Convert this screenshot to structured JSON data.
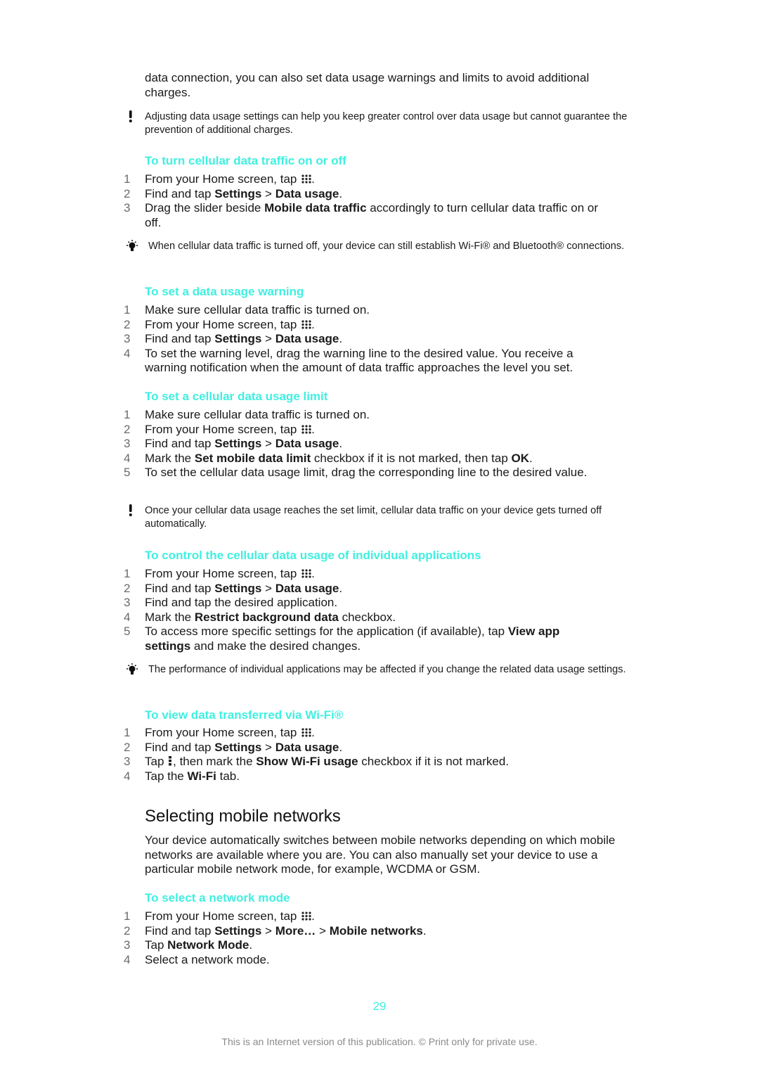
{
  "intro": {
    "text": "data connection, you can also set data usage warnings and limits to avoid additional charges."
  },
  "note_warning_1": {
    "icon": "exclamation-icon",
    "text": "Adjusting data usage settings can help you keep greater control over data usage but cannot guarantee the prevention of additional charges."
  },
  "sections": [
    {
      "heading": "To turn cellular data traffic on or off",
      "steps": [
        {
          "num": "1",
          "parts": [
            {
              "t": "From your Home screen, tap "
            },
            {
              "icon": "app-grid-icon"
            },
            {
              "t": "."
            }
          ]
        },
        {
          "num": "2",
          "parts": [
            {
              "t": "Find and tap "
            },
            {
              "b": "Settings"
            },
            {
              "t": " > "
            },
            {
              "b": "Data usage"
            },
            {
              "t": "."
            }
          ]
        },
        {
          "num": "3",
          "parts": [
            {
              "t": "Drag the slider beside "
            },
            {
              "b": "Mobile data traffic"
            },
            {
              "t": " accordingly to turn cellular data traffic on or off."
            }
          ]
        }
      ],
      "note": {
        "type": "tip",
        "icon": "lightbulb-icon",
        "text": "When cellular data traffic is turned off, your device can still establish Wi-Fi® and Bluetooth® connections."
      }
    },
    {
      "heading": "To set a data usage warning",
      "steps": [
        {
          "num": "1",
          "parts": [
            {
              "t": "Make sure cellular data traffic is turned on."
            }
          ]
        },
        {
          "num": "2",
          "parts": [
            {
              "t": "From your Home screen, tap "
            },
            {
              "icon": "app-grid-icon"
            },
            {
              "t": "."
            }
          ]
        },
        {
          "num": "3",
          "parts": [
            {
              "t": "Find and tap "
            },
            {
              "b": "Settings"
            },
            {
              "t": " > "
            },
            {
              "b": "Data usage"
            },
            {
              "t": "."
            }
          ]
        },
        {
          "num": "4",
          "parts": [
            {
              "t": "To set the warning level, drag the warning line to the desired value. You receive a warning notification when the amount of data traffic approaches the level you set."
            }
          ]
        }
      ]
    },
    {
      "heading": "To set a cellular data usage limit",
      "steps": [
        {
          "num": "1",
          "parts": [
            {
              "t": "Make sure cellular data traffic is turned on."
            }
          ]
        },
        {
          "num": "2",
          "parts": [
            {
              "t": "From your Home screen, tap "
            },
            {
              "icon": "app-grid-icon"
            },
            {
              "t": "."
            }
          ]
        },
        {
          "num": "3",
          "parts": [
            {
              "t": "Find and tap "
            },
            {
              "b": "Settings"
            },
            {
              "t": " > "
            },
            {
              "b": "Data usage"
            },
            {
              "t": "."
            }
          ]
        },
        {
          "num": "4",
          "parts": [
            {
              "t": "Mark the "
            },
            {
              "b": "Set mobile data limit"
            },
            {
              "t": " checkbox if it is not marked, then tap "
            },
            {
              "b": "OK"
            },
            {
              "t": "."
            }
          ]
        },
        {
          "num": "5",
          "parts": [
            {
              "t": "To set the cellular data usage limit, drag the corresponding line to the desired value."
            }
          ]
        }
      ],
      "note": {
        "type": "warning",
        "icon": "exclamation-icon",
        "text": "Once your cellular data usage reaches the set limit, cellular data traffic on your device gets turned off automatically."
      }
    },
    {
      "heading": "To control the cellular data usage of individual applications",
      "steps": [
        {
          "num": "1",
          "parts": [
            {
              "t": "From your Home screen, tap "
            },
            {
              "icon": "app-grid-icon"
            },
            {
              "t": "."
            }
          ]
        },
        {
          "num": "2",
          "parts": [
            {
              "t": "Find and tap "
            },
            {
              "b": "Settings"
            },
            {
              "t": " > "
            },
            {
              "b": "Data usage"
            },
            {
              "t": "."
            }
          ]
        },
        {
          "num": "3",
          "parts": [
            {
              "t": "Find and tap the desired application."
            }
          ]
        },
        {
          "num": "4",
          "parts": [
            {
              "t": "Mark the "
            },
            {
              "b": "Restrict background data"
            },
            {
              "t": " checkbox."
            }
          ]
        },
        {
          "num": "5",
          "parts": [
            {
              "t": "To access more specific settings for the application (if available), tap "
            },
            {
              "b": "View app settings"
            },
            {
              "t": " and make the desired changes."
            }
          ]
        }
      ],
      "note": {
        "type": "tip",
        "icon": "lightbulb-icon",
        "text": "The performance of individual applications may be affected if you change the related data usage settings."
      }
    },
    {
      "heading": "To view data transferred via Wi-Fi®",
      "steps": [
        {
          "num": "1",
          "parts": [
            {
              "t": "From your Home screen, tap "
            },
            {
              "icon": "app-grid-icon"
            },
            {
              "t": "."
            }
          ]
        },
        {
          "num": "2",
          "parts": [
            {
              "t": "Find and tap "
            },
            {
              "b": "Settings"
            },
            {
              "t": " > "
            },
            {
              "b": "Data usage"
            },
            {
              "t": "."
            }
          ]
        },
        {
          "num": "3",
          "parts": [
            {
              "t": "Tap "
            },
            {
              "icon": "overflow-menu-icon"
            },
            {
              "t": ", then mark the "
            },
            {
              "b": "Show Wi-Fi usage"
            },
            {
              "t": " checkbox if it is not marked."
            }
          ]
        },
        {
          "num": "4",
          "parts": [
            {
              "t": "Tap the "
            },
            {
              "b": "Wi-Fi"
            },
            {
              "t": " tab."
            }
          ]
        }
      ]
    }
  ],
  "networks": {
    "title": "Selecting mobile networks",
    "body": "Your device automatically switches between mobile networks depending on which mobile networks are available where you are. You can also manually set your device to use a particular mobile network mode, for example, WCDMA or GSM.",
    "section": {
      "heading": "To select a network mode",
      "steps": [
        {
          "num": "1",
          "parts": [
            {
              "t": "From your Home screen, tap "
            },
            {
              "icon": "app-grid-icon"
            },
            {
              "t": "."
            }
          ]
        },
        {
          "num": "2",
          "parts": [
            {
              "t": "Find and tap "
            },
            {
              "b": "Settings"
            },
            {
              "t": " > "
            },
            {
              "b": "More…"
            },
            {
              "t": " > "
            },
            {
              "b": "Mobile networks"
            },
            {
              "t": "."
            }
          ]
        },
        {
          "num": "3",
          "parts": [
            {
              "t": "Tap "
            },
            {
              "b": "Network Mode"
            },
            {
              "t": "."
            }
          ]
        },
        {
          "num": "4",
          "parts": [
            {
              "t": "Select a network mode."
            }
          ]
        }
      ]
    }
  },
  "page_number": "29",
  "footer": "This is an Internet version of this publication. © Print only for private use.",
  "colors": {
    "heading_accent": "#3ff0e0",
    "step_number": "#6a6a6a",
    "body_text": "#1a1a1a",
    "footer_text": "#8a8a8a"
  }
}
